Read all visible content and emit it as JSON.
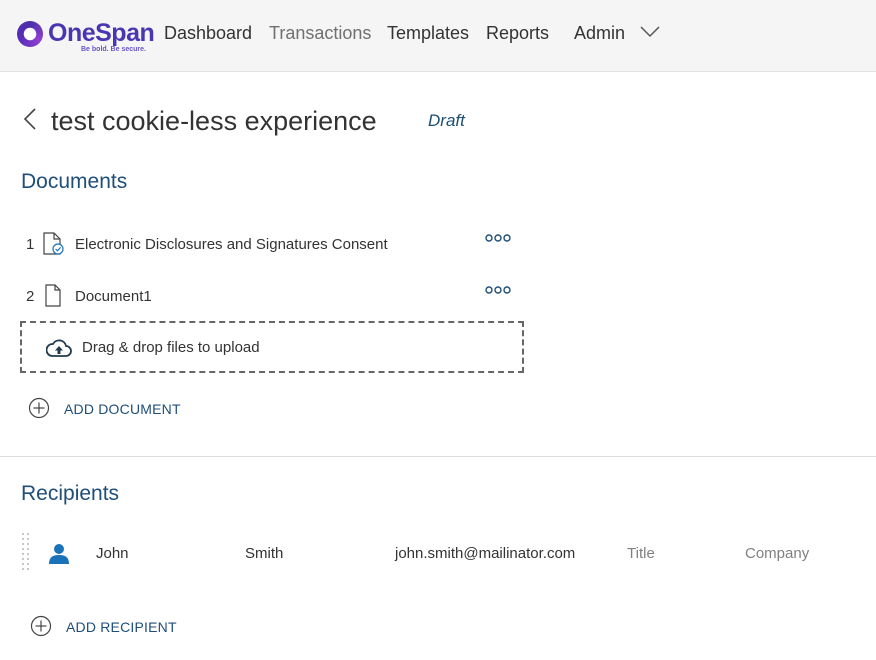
{
  "header": {
    "logo": {
      "name": "OneSpan",
      "tagline": "Be bold. Be secure."
    },
    "nav": [
      {
        "label": "Dashboard"
      },
      {
        "label": "Transactions"
      },
      {
        "label": "Templates"
      },
      {
        "label": "Reports"
      },
      {
        "label": "Admin"
      }
    ]
  },
  "transaction": {
    "title": "test cookie-less experience",
    "status": "Draft"
  },
  "documents": {
    "heading": "Documents",
    "items": [
      {
        "number": "1",
        "name": "Electronic Disclosures and Signatures Consent",
        "icon": "document-check-icon"
      },
      {
        "number": "2",
        "name": "Document1",
        "icon": "document-icon"
      }
    ],
    "dropzone_text": "Drag & drop files to upload",
    "add_label": "ADD DOCUMENT"
  },
  "recipients": {
    "heading": "Recipients",
    "items": [
      {
        "first_name": "John",
        "last_name": "Smith",
        "email": "john.smith@mailinator.com",
        "title_placeholder": "Title",
        "company_placeholder": "Company"
      }
    ],
    "add_label": "ADD RECIPIENT"
  },
  "colors": {
    "brand": "#4a35b3",
    "heading": "#1f4e79",
    "user_icon": "#1a73b8"
  }
}
